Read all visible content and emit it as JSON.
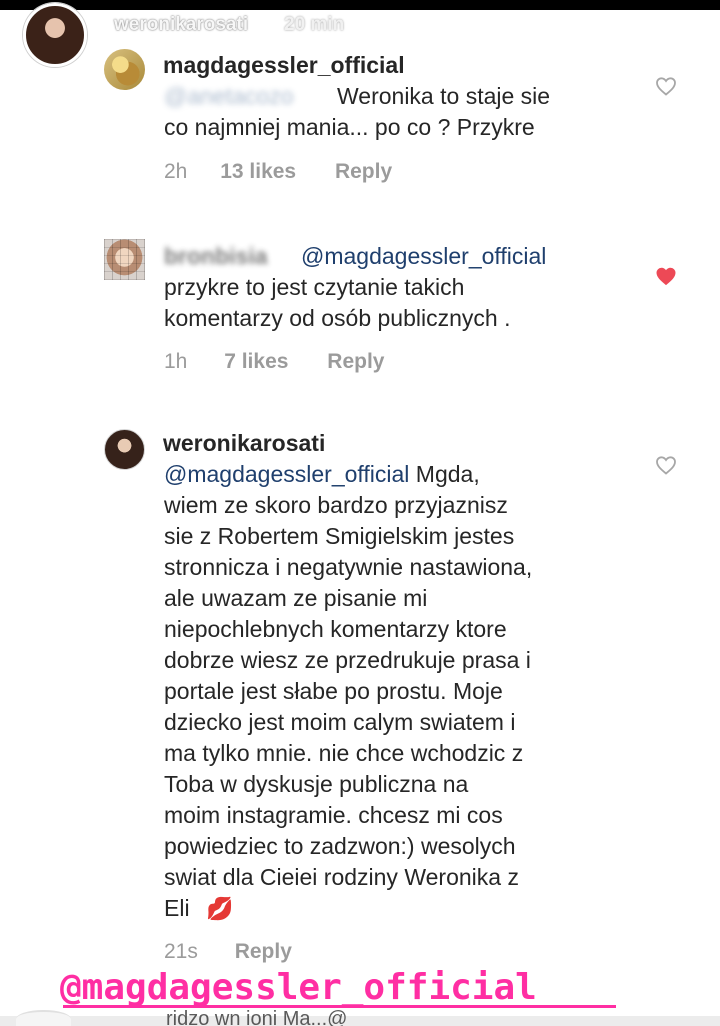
{
  "story": {
    "username": "weronikarosati",
    "time": "20 min"
  },
  "comments": [
    {
      "username": "magdagessler_official",
      "blurred_mention": "@anetacozo",
      "lines": [
        "Weronika to staje sie",
        "co najmniej mania... po co ? Przykre"
      ],
      "time": "2h",
      "likes": "13 likes",
      "reply": "Reply",
      "liked": false
    },
    {
      "username": "bronbisia",
      "mention": "@magdagessler_official",
      "lines": [
        "przykre to jest czytanie takich",
        "komentarzy od osób publicznych ."
      ],
      "time": "1h",
      "likes": "7 likes",
      "reply": "Reply",
      "liked": true
    },
    {
      "username": "weronikarosati",
      "mention": "@magdagessler_official",
      "first_line_rest": " Mgda,",
      "lines": [
        "wiem ze skoro bardzo przyjaznisz",
        "sie z Robertem Smigielskim jestes",
        "stronnicza i negatywnie nastawiona,",
        "ale uwazam ze pisanie mi",
        "niepochlebnych komentarzy ktore",
        "dobrze wiesz ze przedrukuje prasa i",
        "portale jest słabe po prostu. Moje",
        "dziecko jest moim calym swiatem i",
        "ma tylko mnie. nie chce wchodzic z",
        "Toba w  dyskusje publiczna na",
        "moim instagramie. chcesz mi cos",
        "powiedziec to zadzwon:) wesolych",
        "swiat dla Cieiei rodziny Weronika z",
        "Eli"
      ],
      "emoji": "💋",
      "time": "21s",
      "reply": "Reply",
      "liked": false
    }
  ],
  "sticker": {
    "mention": "@magdagessler_official"
  },
  "bottom": {
    "text": "ridzo wn ioni Ma...@"
  },
  "colors": {
    "accent": "#ff2ea3",
    "text": "#262626",
    "meta": "#9b9b9b",
    "mention": "#1f3f6d",
    "liked_heart": "#ed4956"
  }
}
